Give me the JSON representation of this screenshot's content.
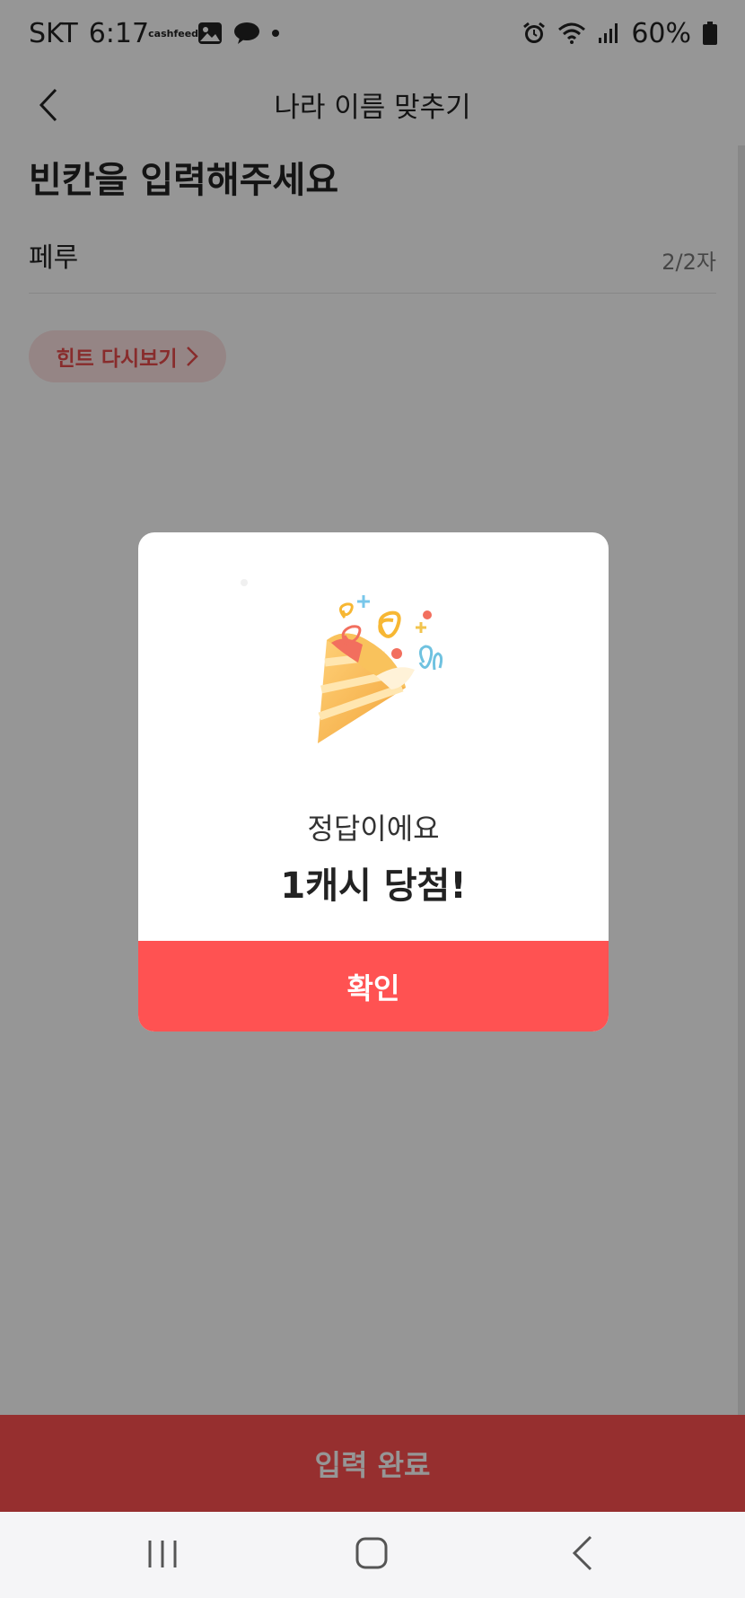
{
  "status_bar": {
    "carrier": "SKT",
    "time": "6:17",
    "cashfeed_line1": "cash",
    "cashfeed_line2": "feed",
    "battery_percent": "60%",
    "icons": [
      "cashfeed-icon",
      "gallery-icon",
      "chat-icon",
      "dot-icon",
      "alarm-icon",
      "wifi-icon",
      "signal-icon",
      "battery-icon"
    ]
  },
  "header": {
    "title": "나라 이름 맞추기",
    "back_icon": "chevron-left-icon"
  },
  "main": {
    "heading": "빈칸을 입력해주세요",
    "answer_value": "페루",
    "char_count": "2/2자",
    "hint_button_label": "힌트 다시보기"
  },
  "footer": {
    "submit_label": "입력 완료"
  },
  "modal": {
    "illustration": "party-popper-icon",
    "message": "정답이에요",
    "reward": "1캐시 당첨!",
    "confirm_label": "확인"
  },
  "nav_bar": {
    "icons": [
      "recent-apps-icon",
      "home-icon",
      "back-icon"
    ]
  },
  "colors": {
    "accent": "#ff5050",
    "hint_bg": "#fde3e3",
    "hint_text": "#e84c4c",
    "overlay": "rgba(0,0,0,0.41)"
  }
}
